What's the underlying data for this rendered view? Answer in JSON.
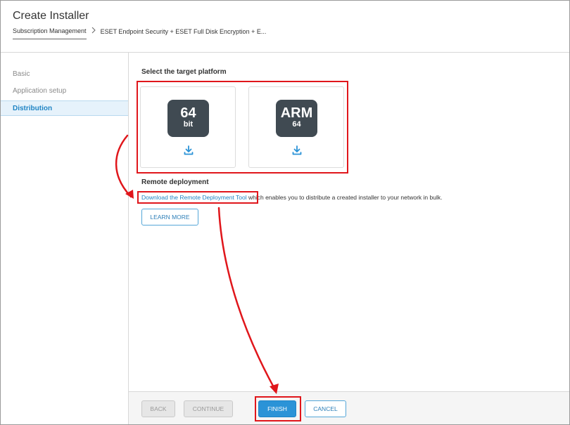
{
  "header": {
    "title": "Create Installer",
    "breadcrumb_root": "Subscription Management",
    "breadcrumb_current": "ESET Endpoint Security + ESET Full Disk Encryption + E..."
  },
  "sidebar": {
    "items": [
      {
        "label": "Basic",
        "state": "inactive"
      },
      {
        "label": "Application setup",
        "state": "inactive"
      },
      {
        "label": "Distribution",
        "state": "active"
      }
    ]
  },
  "main": {
    "platform_section_title": "Select the target platform",
    "platforms": [
      {
        "big": "64",
        "small": "bit",
        "icon": "download-icon"
      },
      {
        "big": "ARM",
        "small": "64",
        "icon": "download-icon"
      }
    ],
    "remote_section_title": "Remote deployment",
    "remote_link": "Download the Remote Deployment Tool",
    "remote_text": " which enables you to distribute a created installer to your network in bulk.",
    "learn_more": "LEARN MORE"
  },
  "footer": {
    "back": "BACK",
    "continue": "CONTINUE",
    "finish": "FINISH",
    "cancel": "CANCEL"
  },
  "colors": {
    "accent": "#2b93d7",
    "link": "#1f84c4",
    "badge": "#404a52",
    "annotation": "#e0161b"
  }
}
